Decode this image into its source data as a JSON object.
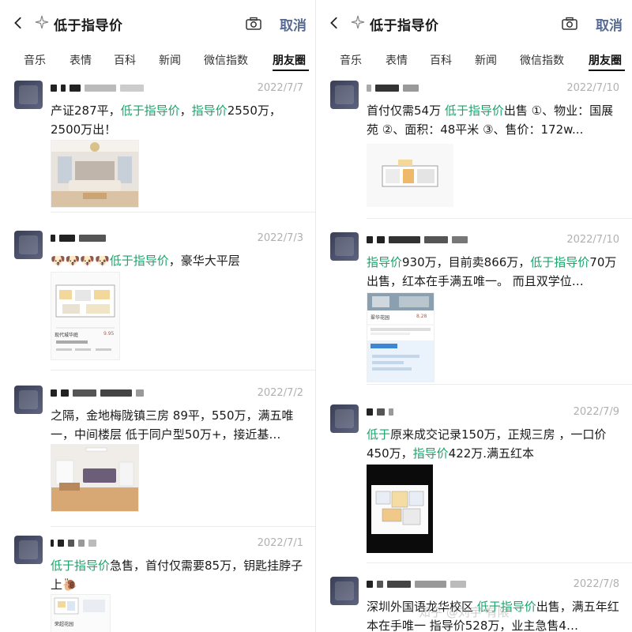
{
  "search": {
    "query": "低于指导价",
    "cancel_label": "取消"
  },
  "tabs": [
    "音乐",
    "表情",
    "百科",
    "新闻",
    "微信指数",
    "朋友圈"
  ],
  "active_tab": "朋友圈",
  "left_posts": [
    {
      "date": "2022/7/7",
      "segments": [
        {
          "t": "产证287平，"
        },
        {
          "t": "低于指导价",
          "h": true
        },
        {
          "t": "，"
        },
        {
          "t": "指导价",
          "h": true
        },
        {
          "t": "2550万，2500万出！"
        }
      ]
    },
    {
      "date": "2022/7/3",
      "segments": [
        {
          "t": "🐶🐶🐶🐶"
        },
        {
          "t": "低于指导价",
          "h": true
        },
        {
          "t": "，豪华大平层"
        }
      ],
      "img_caption": "现代城华庭",
      "img_price": "9.95"
    },
    {
      "date": "2022/7/2",
      "segments": [
        {
          "t": "之隔，金地梅陇镇三房 89平，550万，满五唯一，中间楼层 低于同户型50万+，接近基…"
        }
      ]
    },
    {
      "date": "2022/7/1",
      "segments": [
        {
          "t": "低于指导价",
          "h": true
        },
        {
          "t": "急售，首付仅需要85万，钥匙挂脖子上🐌"
        }
      ],
      "img_caption": "荣超花园"
    }
  ],
  "right_posts": [
    {
      "date": "2022/7/10",
      "segments": [
        {
          "t": "首付仅需54万 "
        },
        {
          "t": "低于指导价",
          "h": true
        },
        {
          "t": "出售 ①、物业：国展苑 ②、面积：48平米 ③、售价：172w..."
        }
      ]
    },
    {
      "date": "2022/7/10",
      "segments": [
        {
          "t": "指导价",
          "h": true
        },
        {
          "t": "930万，目前卖866万，"
        },
        {
          "t": "低于指导价",
          "h": true
        },
        {
          "t": "70万出售，红本在手满五唯一。 而且双学位…"
        }
      ],
      "img_caption": "翠华花园",
      "img_price": "8.28"
    },
    {
      "date": "2022/7/9",
      "segments": [
        {
          "t": "低于",
          "h": true
        },
        {
          "t": "原来成交记录150万，正规三房 ，一口价450万，"
        },
        {
          "t": "指导价",
          "h": true
        },
        {
          "t": "422万.满五红本"
        }
      ]
    },
    {
      "date": "2022/7/8",
      "segments": [
        {
          "t": "深圳外国语龙华校区 "
        },
        {
          "t": "低于指导价",
          "h": true
        },
        {
          "t": "出售，满五年红本在手唯一 指导价528万，业主急售4…"
        }
      ]
    }
  ],
  "watermark": "知乎 @刘宇 有限"
}
